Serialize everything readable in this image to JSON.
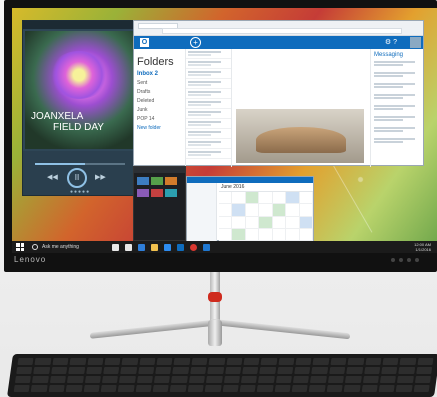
{
  "monitor": {
    "brand": "Lenovo"
  },
  "music": {
    "artist_line1": "JOANXELA",
    "artist_line2": "FIELD DAY",
    "controls": {
      "prev": "◀◀",
      "play": "II",
      "next": "▶▶"
    },
    "progress": 0.55
  },
  "mail": {
    "folders_title": "Folders",
    "folder_items": [
      "Inbox 2",
      "Sent",
      "Drafts",
      "Deleted",
      "Junk",
      "POP 14",
      "New folder"
    ],
    "messaging_title": "Messaging"
  },
  "calendar": {
    "title": "June 2016"
  },
  "taskbar": {
    "search_placeholder": "Ask me anything",
    "time": "12:00 AM",
    "date": "1/1/2016"
  },
  "colors": {
    "accent": "#0f6cbd",
    "stand_ring": "#cf2b1e"
  }
}
